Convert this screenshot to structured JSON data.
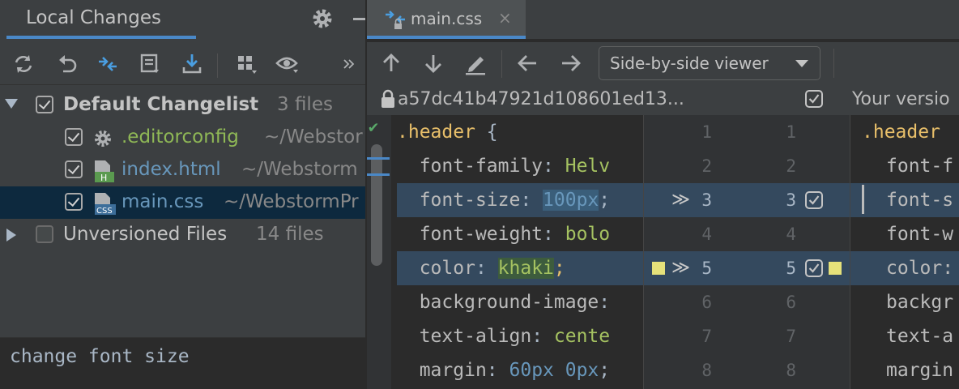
{
  "left_panel": {
    "title": "Local Changes",
    "tree": [
      {
        "label": "Default Changelist",
        "extra": "3 files",
        "checked": true,
        "expanded": true,
        "icon": "none"
      },
      {
        "label": ".editorconfig",
        "extra": "~/Webstor",
        "checked": true,
        "icon": "gear-icon",
        "color": "#8fb856"
      },
      {
        "label": "index.html",
        "extra": "~/Webstorm",
        "checked": true,
        "icon": "html-file-icon",
        "color": "#6897bb"
      },
      {
        "label": "main.css",
        "extra": "~/WebstormPr",
        "checked": true,
        "icon": "css-file-icon",
        "color": "#6897bb"
      },
      {
        "label": "Unversioned Files",
        "extra": "14 files",
        "checked": false,
        "expanded": false,
        "icon": "none"
      }
    ],
    "commit_message": "change font size"
  },
  "editor": {
    "tab_label": "main.css",
    "tab_close": "×",
    "viewer_mode": "Side-by-side viewer",
    "revision_hash": "a57dc41b47921d108601ed13...",
    "your_version_label": "Your versio",
    "left_lines": [
      {
        "sel": ".header",
        "rest": " {"
      },
      {
        "prop": "font-family",
        "val": "Helv"
      },
      {
        "prop": "font-size",
        "num": "100px",
        "tail": ";"
      },
      {
        "prop": "font-weight",
        "val": "bolo"
      },
      {
        "prop": "color",
        "val": "khaki",
        "tail": ";"
      },
      {
        "prop": "background-image",
        "val": ":"
      },
      {
        "prop": "text-align",
        "val": "cente"
      },
      {
        "prop": "margin",
        "num": "60px 0px",
        "tail": ";"
      }
    ],
    "line_numbers": [
      {
        "left": "1",
        "right": "1"
      },
      {
        "left": "2",
        "right": "2"
      },
      {
        "left": "3",
        "right": "3"
      },
      {
        "left": "4",
        "right": "4"
      },
      {
        "left": "5",
        "right": "5"
      },
      {
        "left": "6",
        "right": "6"
      },
      {
        "left": "7",
        "right": "7"
      },
      {
        "left": "8",
        "right": "8"
      }
    ],
    "apply_arrow": "≫",
    "right_lines": [
      ".header",
      "font-f",
      "font-s",
      "font-w",
      "color:",
      "backgr",
      "text-a",
      "margin"
    ],
    "colors": {
      "accent": "#4a88c7",
      "changed_bg": "#34495e",
      "marker": "#e5e17a"
    }
  }
}
